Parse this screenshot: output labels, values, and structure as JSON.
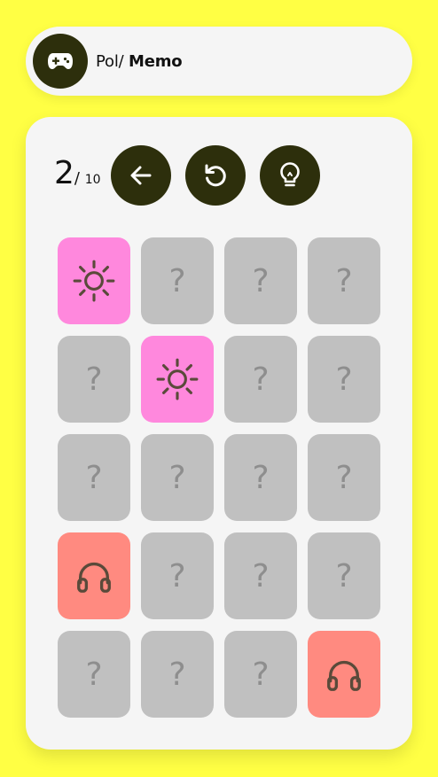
{
  "header": {
    "user": "Pol",
    "separator": "/ ",
    "app": "Memo",
    "icon": "gamepad-icon"
  },
  "score": {
    "current": "2",
    "separator": "/ ",
    "total": "10"
  },
  "controls": [
    {
      "name": "back-button",
      "icon": "arrow-left-icon"
    },
    {
      "name": "restart-button",
      "icon": "rotate-ccw-icon"
    },
    {
      "name": "hint-button",
      "icon": "lightbulb-icon"
    }
  ],
  "board": {
    "hidden_symbol": "?",
    "colors": {
      "hidden": "#c0c0c0",
      "sun": "#ff88dd",
      "headphones": "#ff8a80",
      "icon": "#5a4a3a",
      "button": "#2d2f0c",
      "background": "#ffff44"
    },
    "cards": [
      {
        "state": "revealed",
        "icon": "sun-icon"
      },
      {
        "state": "hidden"
      },
      {
        "state": "hidden"
      },
      {
        "state": "hidden"
      },
      {
        "state": "hidden"
      },
      {
        "state": "revealed",
        "icon": "sun-icon"
      },
      {
        "state": "hidden"
      },
      {
        "state": "hidden"
      },
      {
        "state": "hidden"
      },
      {
        "state": "hidden"
      },
      {
        "state": "hidden"
      },
      {
        "state": "hidden"
      },
      {
        "state": "revealed",
        "icon": "headphones-icon"
      },
      {
        "state": "hidden"
      },
      {
        "state": "hidden"
      },
      {
        "state": "hidden"
      },
      {
        "state": "hidden"
      },
      {
        "state": "hidden"
      },
      {
        "state": "hidden"
      },
      {
        "state": "revealed",
        "icon": "headphones-icon"
      }
    ]
  }
}
